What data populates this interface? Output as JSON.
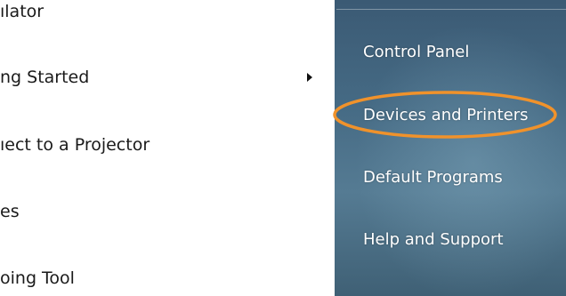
{
  "left_list": {
    "items": [
      {
        "label": "ılator"
      },
      {
        "label": "ng Started"
      },
      {
        "label": "ıect to a Projector"
      },
      {
        "label": "es"
      },
      {
        "label": "oing Tool"
      }
    ]
  },
  "right_list": {
    "items": [
      {
        "label": "Control Panel"
      },
      {
        "label": "Devices and Printers"
      },
      {
        "label": "Default Programs"
      },
      {
        "label": "Help and Support"
      }
    ]
  },
  "colors": {
    "highlight": "#f0922b",
    "right_pane_bg": "#456a84",
    "left_text": "#1a1a1a",
    "right_text": "#ffffff"
  },
  "icons": {
    "submenu_arrow": "chevron-right-icon"
  }
}
